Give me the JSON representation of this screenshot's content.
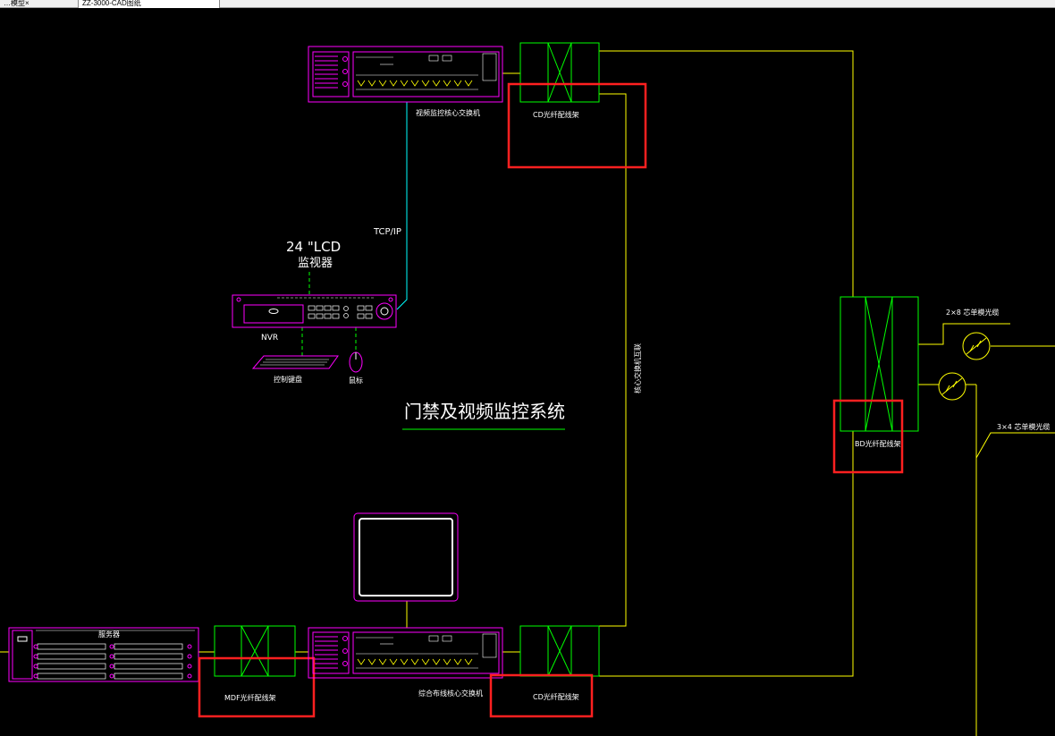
{
  "app": {
    "tabs": [
      {
        "label": "…模型×"
      },
      {
        "label": "ZZ-3000-CAD图纸"
      }
    ]
  },
  "colors": {
    "background": "#000000",
    "device": "#ff00ff",
    "odf": "#00ff00",
    "fiber": "#ffff00",
    "network": "#00ffff",
    "highlight": "#ff2020",
    "text": "#ffffff"
  },
  "diagram": {
    "title": "门禁及视频监控系统",
    "labels": {
      "video_switch": "视频监控核心交换机",
      "cd_odf_top": "CD光纤配线架",
      "tcpip": "TCP/IP",
      "lcd_size": "24 \"LCD",
      "lcd_name": "监视器",
      "nvr": "NVR",
      "keyboard": "控制键盘",
      "mouse": "鼠标",
      "core_link": "核心交换机互联",
      "bd_odf": "BD光纤配线架",
      "cable_2x8": "2×8  芯单模光缆",
      "cable_3x4": "3×4  芯单模光缆",
      "server": "服务器",
      "mdf_odf": "MDF光纤配线架",
      "integrated_switch": "综合布线核心交换机",
      "cd_odf_bottom": "CD光纤配线架"
    }
  }
}
